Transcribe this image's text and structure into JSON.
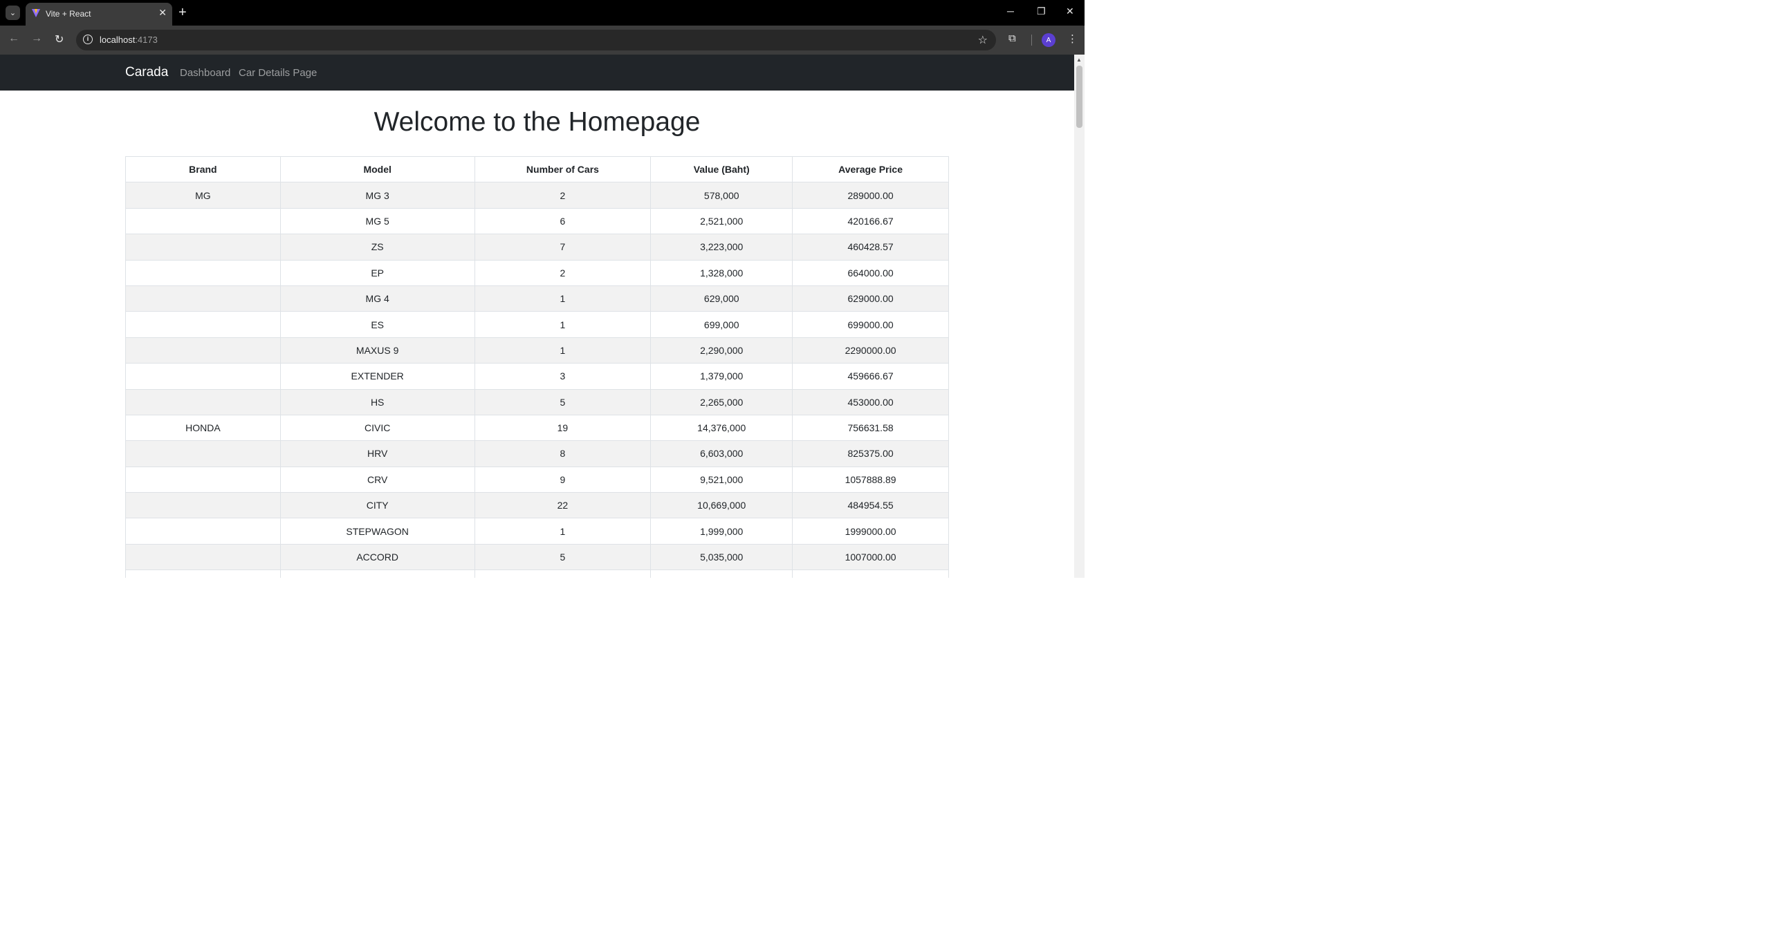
{
  "browser": {
    "tab_title": "Vite + React",
    "url_host": "localhost",
    "url_port": ":4173",
    "profile_initial": "A"
  },
  "navbar": {
    "brand": "Carada",
    "links": [
      "Dashboard",
      "Car Details Page"
    ]
  },
  "page": {
    "title": "Welcome to the Homepage"
  },
  "table": {
    "headers": [
      "Brand",
      "Model",
      "Number of Cars",
      "Value (Baht)",
      "Average Price"
    ],
    "rows": [
      [
        "MG",
        "MG 3",
        "2",
        "578,000",
        "289000.00"
      ],
      [
        "",
        "MG 5",
        "6",
        "2,521,000",
        "420166.67"
      ],
      [
        "",
        "ZS",
        "7",
        "3,223,000",
        "460428.57"
      ],
      [
        "",
        "EP",
        "2",
        "1,328,000",
        "664000.00"
      ],
      [
        "",
        "MG 4",
        "1",
        "629,000",
        "629000.00"
      ],
      [
        "",
        "ES",
        "1",
        "699,000",
        "699000.00"
      ],
      [
        "",
        "MAXUS 9",
        "1",
        "2,290,000",
        "2290000.00"
      ],
      [
        "",
        "EXTENDER",
        "3",
        "1,379,000",
        "459666.67"
      ],
      [
        "",
        "HS",
        "5",
        "2,265,000",
        "453000.00"
      ],
      [
        "HONDA",
        "CIVIC",
        "19",
        "14,376,000",
        "756631.58"
      ],
      [
        "",
        "HRV",
        "8",
        "6,603,000",
        "825375.00"
      ],
      [
        "",
        "CRV",
        "9",
        "9,521,000",
        "1057888.89"
      ],
      [
        "",
        "CITY",
        "22",
        "10,669,000",
        "484954.55"
      ],
      [
        "",
        "STEPWAGON",
        "1",
        "1,999,000",
        "1999000.00"
      ],
      [
        "",
        "ACCORD",
        "5",
        "5,035,000",
        "1007000.00"
      ],
      [
        "",
        "",
        "",
        "",
        ""
      ]
    ]
  }
}
